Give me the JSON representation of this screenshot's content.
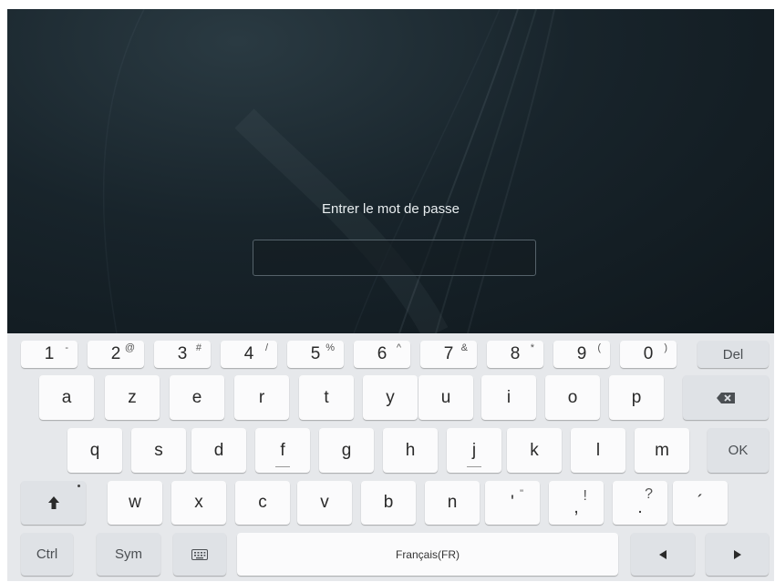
{
  "screen": {
    "prompt": "Entrer le mot de passe",
    "password_value": ""
  },
  "keyboard": {
    "number_row": [
      {
        "main": "1",
        "sup": "-"
      },
      {
        "main": "2",
        "sup": "@"
      },
      {
        "main": "3",
        "sup": "#"
      },
      {
        "main": "4",
        "sup": "/"
      },
      {
        "main": "5",
        "sup": "%"
      },
      {
        "main": "6",
        "sup": "^"
      },
      {
        "main": "7",
        "sup": "&"
      },
      {
        "main": "8",
        "sup": "*"
      },
      {
        "main": "9",
        "sup": "("
      },
      {
        "main": "0",
        "sup": ")"
      }
    ],
    "del_label": "Del",
    "row2": [
      "a",
      "z",
      "e",
      "r",
      "t",
      "y",
      "u",
      "i",
      "o",
      "p"
    ],
    "backspace_icon": "backspace-icon",
    "row3": [
      "q",
      "s",
      "d",
      "f",
      "g",
      "h",
      "j",
      "k",
      "l",
      "m"
    ],
    "ok_label": "OK",
    "shift_icon": "shift-arrow-icon",
    "row4": [
      "w",
      "x",
      "c",
      "v",
      "b",
      "n"
    ],
    "apostrophe_sup": "\"",
    "apostrophe_main": "'",
    "comma_main": ",",
    "comma_sup": "!",
    "period_main": ".",
    "period_sup": "?",
    "accent_main": "´",
    "ctrl_label": "Ctrl",
    "sym_label": "Sym",
    "keyboard_icon": "keyboard-icon",
    "space_label": "Français(FR)",
    "left_arrow_icon": "arrow-left-icon",
    "right_arrow_icon": "arrow-right-icon"
  },
  "colors": {
    "background_dark": "#18242b",
    "keyboard_bg": "#e6e8eb",
    "key_bg": "#fbfbfc",
    "fn_key_bg": "#dfe2e6"
  }
}
